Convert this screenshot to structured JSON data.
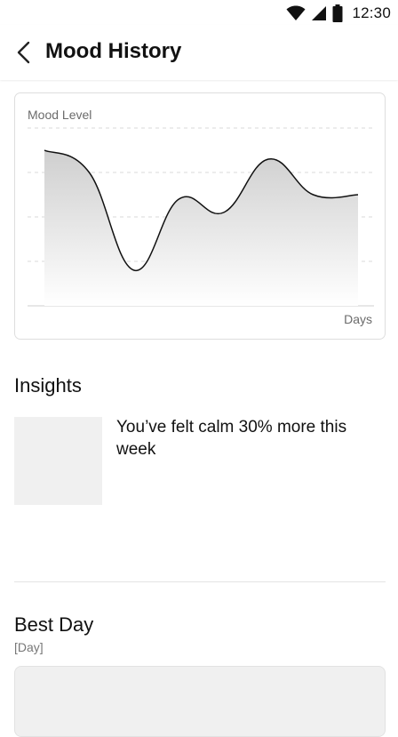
{
  "status_bar": {
    "time": "12:30",
    "icons": [
      "wifi-icon",
      "signal-icon",
      "battery-icon"
    ]
  },
  "header": {
    "title": "Mood History",
    "back_icon": "chevron-left-icon"
  },
  "chart_data": {
    "type": "area",
    "ylabel": "Mood Level",
    "xlabel": "Days",
    "grid": true,
    "curve": "smooth",
    "x": [
      0,
      1,
      2,
      3,
      4,
      5,
      6,
      7
    ],
    "values": [
      3.5,
      3.0,
      0.8,
      2.4,
      2.1,
      3.3,
      2.5,
      2.5
    ],
    "ylim": [
      0,
      4
    ],
    "colors": {
      "line": "#111111",
      "fill_top": "#cfcfcf",
      "fill_bottom": "#ffffff",
      "grid": "#d9d9d9"
    }
  },
  "insights": {
    "heading": "Insights",
    "text": "You’ve felt calm 30% more this week"
  },
  "best_day": {
    "heading": "Best Day",
    "value": "[Day]"
  }
}
